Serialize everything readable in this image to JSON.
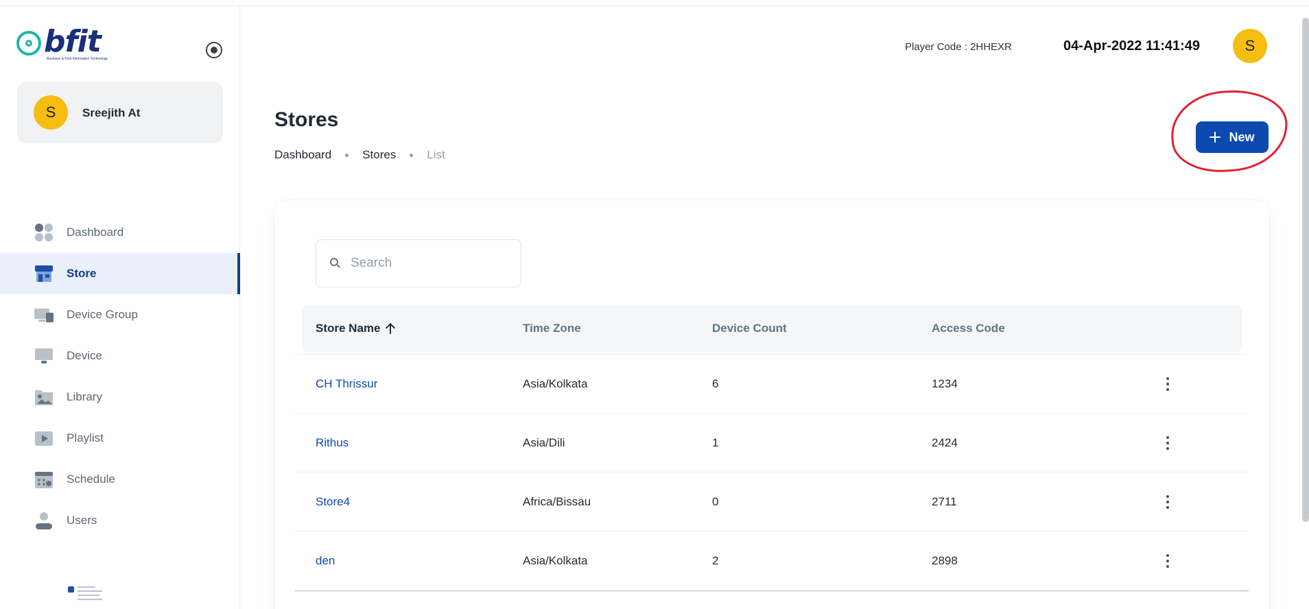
{
  "app": {
    "logo_text": "bfit",
    "logo_subtext": "Business & First Information Technology"
  },
  "user": {
    "name": "Sreejith At",
    "avatar_letter": "S"
  },
  "header": {
    "player_code": "Player Code : 2HHEXR",
    "datetime": "04-Apr-2022 11:41:49",
    "avatar_letter": "S"
  },
  "sidebar": {
    "items": [
      {
        "label": "Dashboard",
        "icon": "dashboard-icon",
        "active": false
      },
      {
        "label": "Store",
        "icon": "store-icon",
        "active": true
      },
      {
        "label": "Device Group",
        "icon": "device-group-icon",
        "active": false
      },
      {
        "label": "Device",
        "icon": "device-icon",
        "active": false
      },
      {
        "label": "Library",
        "icon": "library-icon",
        "active": false
      },
      {
        "label": "Playlist",
        "icon": "playlist-icon",
        "active": false
      },
      {
        "label": "Schedule",
        "icon": "schedule-icon",
        "active": false
      },
      {
        "label": "Users",
        "icon": "users-icon",
        "active": false
      }
    ]
  },
  "page": {
    "title": "Stores",
    "breadcrumb": [
      "Dashboard",
      "Stores",
      "List"
    ],
    "new_button_label": "New"
  },
  "search": {
    "placeholder": "Search",
    "value": ""
  },
  "table": {
    "columns": [
      "Store Name",
      "Time Zone",
      "Device Count",
      "Access Code"
    ],
    "sorted_column": "Store Name",
    "sort_direction": "ascending",
    "rows": [
      {
        "store_name": "CH Thrissur",
        "time_zone": "Asia/Kolkata",
        "device_count": "6",
        "access_code": "1234"
      },
      {
        "store_name": "Rithus",
        "time_zone": "Asia/Dili",
        "device_count": "1",
        "access_code": "2424"
      },
      {
        "store_name": "Store4",
        "time_zone": "Africa/Bissau",
        "device_count": "0",
        "access_code": "2711"
      },
      {
        "store_name": "den",
        "time_zone": "Asia/Kolkata",
        "device_count": "2",
        "access_code": "2898"
      }
    ]
  },
  "colors": {
    "primary": "#0d4ab0",
    "avatar": "#f5bd0e",
    "active_nav_bg": "#e9f0fb",
    "annotation": "#e0212d"
  }
}
